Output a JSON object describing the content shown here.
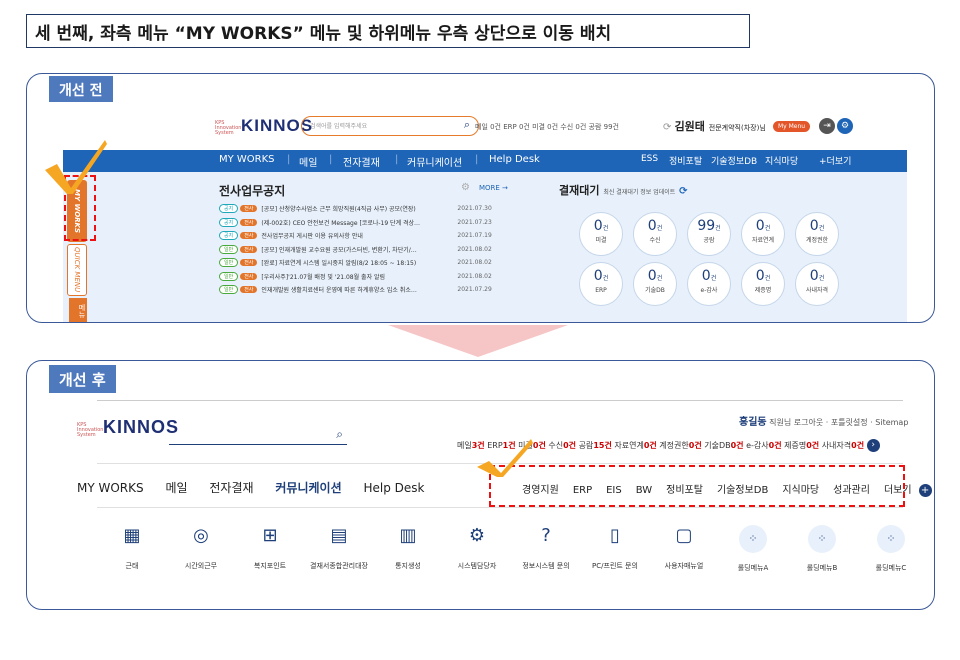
{
  "heading": "세 번째, 좌측 메뉴 “MY WORKS” 메뉴 및 하위메뉴 우측 상단으로 이동 배치",
  "before": {
    "tag": "개선 전",
    "logo": {
      "kps": "KPS Innovation System",
      "word": "KINNOS"
    },
    "search_placeholder": "검색어를 입력해주세요",
    "counts": "메일 0건  ERP 0건  미결 0건  수신 0건  공람 99건",
    "user_name": "김원태",
    "user_title": "전문계약직(차장)님",
    "my_menu": "My Menu",
    "nav": [
      "MY WORKS",
      "메일",
      "전자결재",
      "커뮤니케이션",
      "Help Desk"
    ],
    "nav_right": [
      "ESS",
      "정비포탈",
      "기술정보DB",
      "지식마당",
      "+더보기"
    ],
    "side_tabs": [
      "MY WORKS",
      "QUICK MENU",
      "메뉴"
    ],
    "notice_title": "전사업무공지",
    "notice_more": "MORE →",
    "notices": [
      {
        "b1": "공지",
        "b2": "전사",
        "title": "[공모] 산청양수사업소 근무 희망직원(4직급 사무) 공모(연장)",
        "date": "2021.07.30",
        "green": false
      },
      {
        "b1": "공지",
        "b2": "전사",
        "title": "(제-002호) CEO 안전보건 Message [코로나-19 단계 격상…",
        "date": "2021.07.23",
        "green": false
      },
      {
        "b1": "공지",
        "b2": "전사",
        "title": "전사업무공지 게시판 이용 유의사항 안내",
        "date": "2021.07.19",
        "green": false
      },
      {
        "b1": "일반",
        "b2": "전사",
        "title": "[공모] 인재개발원 교수요원 공모(가스터빈, 변환기, 차단기/…",
        "date": "2021.08.02",
        "green": true
      },
      {
        "b1": "일반",
        "b2": "전사",
        "title": "[완료] 자료연계 시스템 일시중지 알림(8/2 18:05 ~ 18:15)",
        "date": "2021.08.02",
        "green": true
      },
      {
        "b1": "일반",
        "b2": "전사",
        "title": "[우리사주]'21.07월 배정 및 '21.08월 출자 알림",
        "date": "2021.08.02",
        "green": true
      },
      {
        "b1": "일반",
        "b2": "전사",
        "title": "인재개발원 생활치료센터 운영에 따른 하계휴양소 입소 취소…",
        "date": "2021.07.29",
        "green": true
      }
    ],
    "approval_title": "결재대기",
    "approval_sub": "최신 결재대기 정보 업데이트",
    "approvals": [
      {
        "n": "0",
        "u": "건",
        "l": "미결"
      },
      {
        "n": "0",
        "u": "건",
        "l": "수신"
      },
      {
        "n": "99",
        "u": "건",
        "l": "공람"
      },
      {
        "n": "0",
        "u": "건",
        "l": "자료연계"
      },
      {
        "n": "0",
        "u": "건",
        "l": "계정권한"
      },
      {
        "n": "0",
        "u": "건",
        "l": "ERP"
      },
      {
        "n": "0",
        "u": "건",
        "l": "기술DB"
      },
      {
        "n": "0",
        "u": "건",
        "l": "e-감사"
      },
      {
        "n": "0",
        "u": "건",
        "l": "제증명"
      },
      {
        "n": "0",
        "u": "건",
        "l": "사내자격"
      }
    ]
  },
  "after": {
    "tag": "개선 후",
    "logo": {
      "kps": "KPS Innovation System",
      "word": "KINNOS"
    },
    "user_name": "홍길동",
    "user_rest": "직원님   로그아웃 · 포틀릿설정 · Sitemap",
    "counts": [
      {
        "t": "메일",
        "v": "3건"
      },
      {
        "t": "ERP",
        "v": "1건"
      },
      {
        "t": "미결",
        "v": "0건"
      },
      {
        "t": "수신",
        "v": "0건"
      },
      {
        "t": "공람",
        "v": "15건"
      },
      {
        "t": "자료연계",
        "v": "0건"
      },
      {
        "t": "계정권한",
        "v": "0건"
      },
      {
        "t": "기술DB",
        "v": "0건"
      },
      {
        "t": "e-감사",
        "v": "0건"
      },
      {
        "t": "제증명",
        "v": "0건"
      },
      {
        "t": "사내자격",
        "v": "0건"
      }
    ],
    "nav": [
      "MY WORKS",
      "메일",
      "전자결재",
      "커뮤니케이션",
      "Help Desk"
    ],
    "nav_right": [
      "경영지원",
      "ERP",
      "EIS",
      "BW",
      "정비포탈",
      "기술정보DB",
      "지식마당",
      "성과관리",
      "더보기"
    ],
    "quick": [
      {
        "g": "▦",
        "l": "근태"
      },
      {
        "g": "◎",
        "l": "시간외근무"
      },
      {
        "g": "⊞",
        "l": "복지포인트"
      },
      {
        "g": "▤",
        "l": "결재서종합관리대장"
      },
      {
        "g": "▥",
        "l": "통지생성"
      },
      {
        "g": "⚙",
        "l": "시스템담당자"
      },
      {
        "g": "?",
        "l": "정보시스템 문의"
      },
      {
        "g": "▯",
        "l": "PC/프린트 문의"
      },
      {
        "g": "▢",
        "l": "사용자매뉴얼"
      },
      {
        "g": "⁘",
        "l": "롤딩메뉴A",
        "c": true
      },
      {
        "g": "⁘",
        "l": "롤딩메뉴B",
        "c": true
      },
      {
        "g": "⁘",
        "l": "롤딩메뉴C",
        "c": true
      }
    ]
  }
}
